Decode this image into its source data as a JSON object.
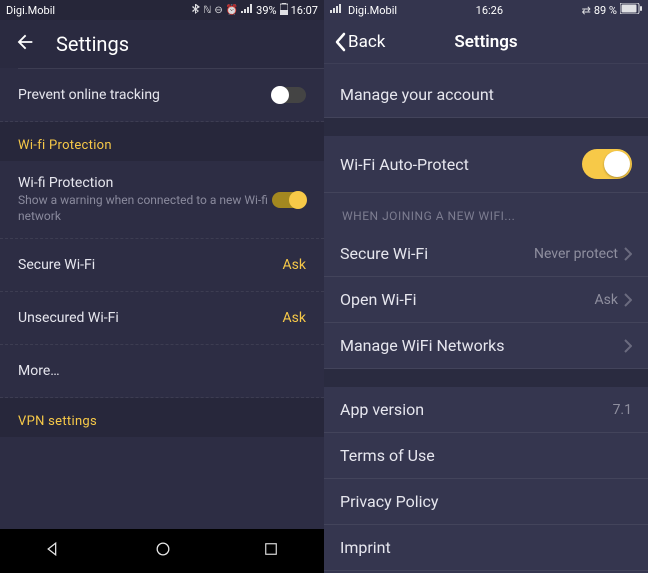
{
  "left": {
    "status": {
      "carrier": "Digi.Mobil",
      "battery": "39%",
      "time": "16:07"
    },
    "header": {
      "title": "Settings"
    },
    "prevent_tracking": {
      "label": "Prevent online tracking"
    },
    "section_wifi": "Wi-fi Protection",
    "wifi_protection": {
      "label": "Wi-fi Protection",
      "sub": "Show a warning when connected to a new Wi-fi network"
    },
    "secure_wifi": {
      "label": "Secure Wi-Fi",
      "value": "Ask"
    },
    "unsecured_wifi": {
      "label": "Unsecured Wi-Fi",
      "value": "Ask"
    },
    "more": {
      "label": "More…"
    },
    "section_vpn": "VPN settings"
  },
  "right": {
    "status": {
      "carrier": "Digi.Mobil",
      "time": "16:26",
      "battery": "89 %"
    },
    "header": {
      "back": "Back",
      "title": "Settings"
    },
    "manage_account": {
      "label": "Manage your account"
    },
    "wifi_auto": {
      "label": "Wi-Fi Auto-Protect"
    },
    "section_join": "WHEN JOINING A NEW WIFI...",
    "secure_wifi": {
      "label": "Secure Wi-Fi",
      "value": "Never protect"
    },
    "open_wifi": {
      "label": "Open Wi-Fi",
      "value": "Ask"
    },
    "manage_networks": {
      "label": "Manage WiFi Networks"
    },
    "app_version": {
      "label": "App version",
      "value": "7.1"
    },
    "terms": {
      "label": "Terms of Use"
    },
    "privacy": {
      "label": "Privacy Policy"
    },
    "imprint": {
      "label": "Imprint"
    }
  }
}
